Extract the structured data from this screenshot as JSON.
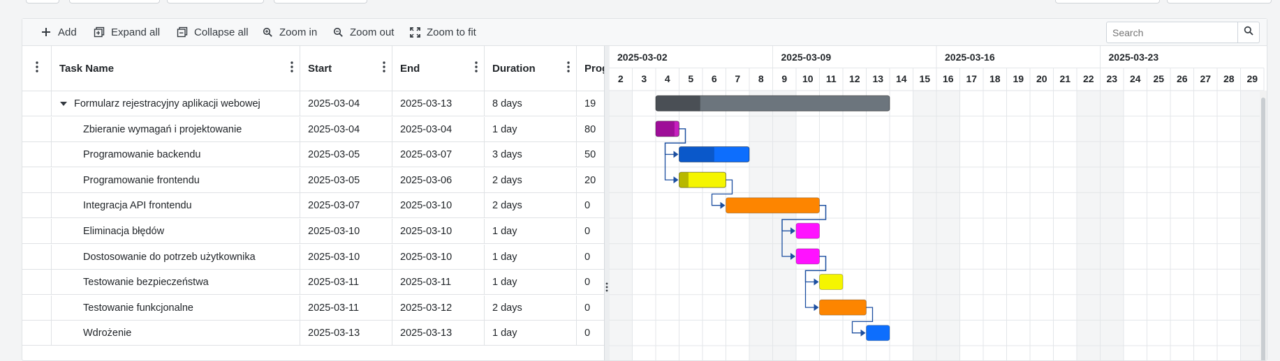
{
  "toolbar": {
    "add": "Add",
    "expand_all": "Expand all",
    "collapse_all": "Collapse all",
    "zoom_in": "Zoom in",
    "zoom_out": "Zoom out",
    "zoom_to_fit": "Zoom to fit",
    "search_placeholder": "Search"
  },
  "columns": [
    "Task Name",
    "Start",
    "End",
    "Duration",
    "Progr"
  ],
  "timeline": {
    "weeks": [
      "2025-03-02",
      "2025-03-09",
      "2025-03-16",
      "2025-03-23"
    ],
    "days": [
      "2",
      "3",
      "4",
      "5",
      "6",
      "7",
      "8",
      "9",
      "10",
      "11",
      "12",
      "13",
      "14",
      "15",
      "16",
      "17",
      "18",
      "19",
      "20",
      "21",
      "22",
      "23",
      "24",
      "25",
      "26",
      "27",
      "28",
      "29"
    ]
  },
  "tasks": [
    {
      "name": "Formularz rejestracyjny aplikacji webowej",
      "start": "2025-03-04",
      "end": "2025-03-13",
      "duration": "8 days",
      "progress": "19",
      "parent": true,
      "color": "#6c757d",
      "done_color": "#4a4f55",
      "s": 2,
      "e": 12
    },
    {
      "name": "Zbieranie wymagań i projektowanie",
      "start": "2025-03-04",
      "end": "2025-03-04",
      "duration": "1 day",
      "progress": "80",
      "parent": false,
      "color": "#c71fbf",
      "done_color": "#9e0e98",
      "s": 2,
      "e": 3
    },
    {
      "name": "Programowanie backendu",
      "start": "2025-03-05",
      "end": "2025-03-07",
      "duration": "3 days",
      "progress": "50",
      "parent": false,
      "color": "#0d6efd",
      "done_color": "#0a58ca",
      "s": 3,
      "e": 6
    },
    {
      "name": "Programowanie frontendu",
      "start": "2025-03-05",
      "end": "2025-03-06",
      "duration": "2 days",
      "progress": "20",
      "parent": false,
      "color": "#f5f500",
      "done_color": "#b8b800",
      "s": 3,
      "e": 5
    },
    {
      "name": "Integracja API frontendu",
      "start": "2025-03-07",
      "end": "2025-03-10",
      "duration": "2 days",
      "progress": "0",
      "parent": false,
      "color": "#fd8500",
      "done_color": "#c96800",
      "s": 5,
      "e": 9
    },
    {
      "name": "Eliminacja błędów",
      "start": "2025-03-10",
      "end": "2025-03-10",
      "duration": "1 day",
      "progress": "0",
      "parent": false,
      "color": "#ff12ff",
      "done_color": "#c000c0",
      "s": 8,
      "e": 9
    },
    {
      "name": "Dostosowanie do potrzeb użytkownika",
      "start": "2025-03-10",
      "end": "2025-03-10",
      "duration": "1 day",
      "progress": "0",
      "parent": false,
      "color": "#ff12ff",
      "done_color": "#c000c0",
      "s": 8,
      "e": 9
    },
    {
      "name": "Testowanie bezpieczeństwa",
      "start": "2025-03-11",
      "end": "2025-03-11",
      "duration": "1 day",
      "progress": "0",
      "parent": false,
      "color": "#f5f500",
      "done_color": "#b8b800",
      "s": 9,
      "e": 10
    },
    {
      "name": "Testowanie funkcjonalne",
      "start": "2025-03-11",
      "end": "2025-03-12",
      "duration": "2 days",
      "progress": "0",
      "parent": false,
      "color": "#fd8500",
      "done_color": "#c96800",
      "s": 9,
      "e": 11
    },
    {
      "name": "Wdrożenie",
      "start": "2025-03-13",
      "end": "2025-03-13",
      "duration": "1 day",
      "progress": "0",
      "parent": false,
      "color": "#0d6efd",
      "done_color": "#0a58ca",
      "s": 11,
      "e": 12
    }
  ],
  "links": [
    [
      1,
      2
    ],
    [
      1,
      3
    ],
    [
      3,
      4
    ],
    [
      4,
      5
    ],
    [
      4,
      6
    ],
    [
      6,
      7
    ],
    [
      6,
      8
    ],
    [
      8,
      9
    ]
  ],
  "colors": {
    "weekend_shade": "#f4f5f6",
    "grid_line": "#e3e6e9",
    "link": "#1c4fa0"
  }
}
